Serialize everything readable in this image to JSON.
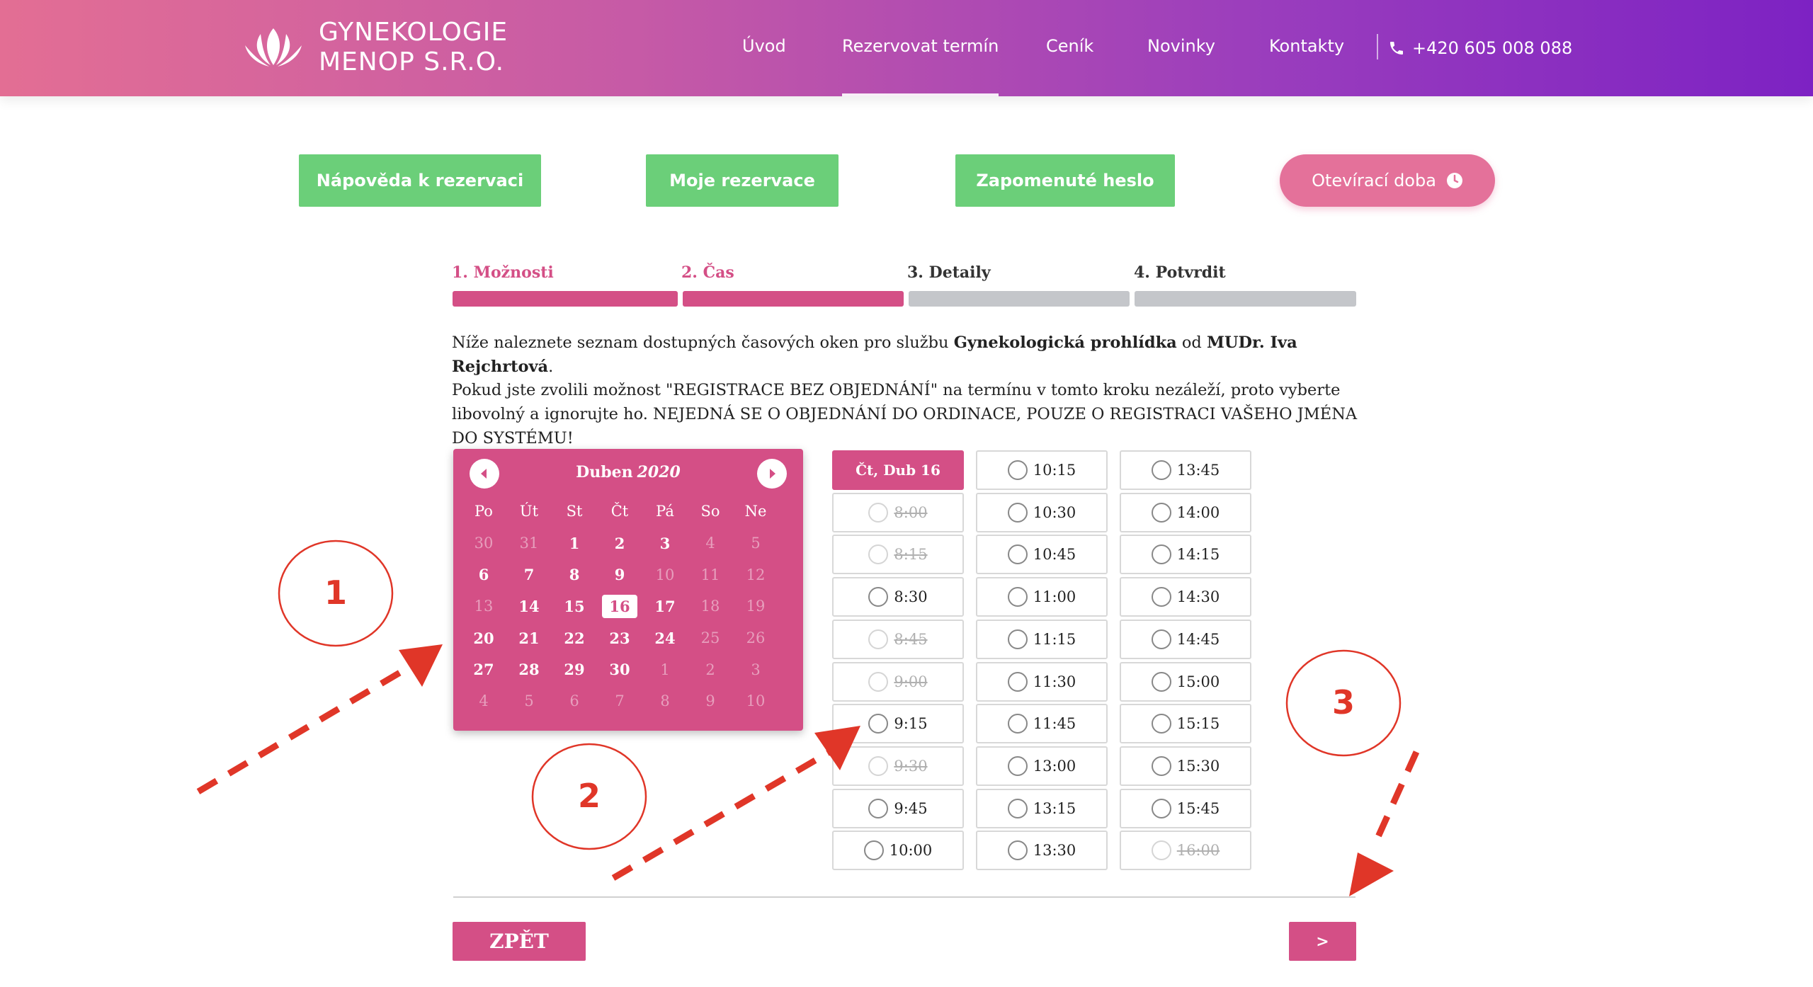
{
  "brand": {
    "line1": "GYNEKOLOGIE",
    "line2": "MENOP S.R.O."
  },
  "nav": {
    "items": [
      "Úvod",
      "Rezervovat termín",
      "Ceník",
      "Novinky",
      "Kontakty"
    ],
    "active": "Rezervovat termín",
    "phone": "+420 605 008 088"
  },
  "top_buttons": {
    "help": "Nápověda k rezervaci",
    "my_reservations": "Moje rezervace",
    "forgot_password": "Zapomenuté heslo",
    "opening_hours": "Otevírací doba"
  },
  "steps": [
    {
      "label": "1. Možnosti",
      "state": "done"
    },
    {
      "label": "2. Čas",
      "state": "done"
    },
    {
      "label": "3. Detaily",
      "state": "todo"
    },
    {
      "label": "4. Potvrdit",
      "state": "todo"
    }
  ],
  "intro": {
    "p1_a": "Níže naleznete seznam dostupných časových oken pro službu ",
    "p1_service": "Gynekologická prohlídka",
    "p1_b": " od ",
    "p1_doctor": "MUDr. Iva Rejchrtová",
    "p1_c": ".",
    "p2": "Pokud jste zvolili možnost \"REGISTRACE BEZ OBJEDNÁNÍ\" na termínu v tomto kroku nezáleží, proto vyberte libovolný a ignorujte ho. NEJEDNÁ SE O OBJEDNÁNÍ DO ORDINACE, POUZE O REGISTRACI VAŠEHO JMÉNA DO SYSTÉMU!"
  },
  "calendar": {
    "month": "Duben",
    "year": "2020",
    "weekdays": [
      "Po",
      "Út",
      "St",
      "Čt",
      "Pá",
      "So",
      "Ne"
    ],
    "weeks": [
      [
        {
          "d": "30",
          "s": "dim"
        },
        {
          "d": "31",
          "s": "dim"
        },
        {
          "d": "1",
          "s": "avail"
        },
        {
          "d": "2",
          "s": "avail"
        },
        {
          "d": "3",
          "s": "avail"
        },
        {
          "d": "4",
          "s": "dim"
        },
        {
          "d": "5",
          "s": "dim"
        }
      ],
      [
        {
          "d": "6",
          "s": "avail"
        },
        {
          "d": "7",
          "s": "avail"
        },
        {
          "d": "8",
          "s": "avail"
        },
        {
          "d": "9",
          "s": "avail"
        },
        {
          "d": "10",
          "s": "dim"
        },
        {
          "d": "11",
          "s": "dim"
        },
        {
          "d": "12",
          "s": "dim"
        }
      ],
      [
        {
          "d": "13",
          "s": "dim"
        },
        {
          "d": "14",
          "s": "avail"
        },
        {
          "d": "15",
          "s": "avail"
        },
        {
          "d": "16",
          "s": "sel"
        },
        {
          "d": "17",
          "s": "avail"
        },
        {
          "d": "18",
          "s": "dim"
        },
        {
          "d": "19",
          "s": "dim"
        }
      ],
      [
        {
          "d": "20",
          "s": "avail"
        },
        {
          "d": "21",
          "s": "avail"
        },
        {
          "d": "22",
          "s": "avail"
        },
        {
          "d": "23",
          "s": "avail"
        },
        {
          "d": "24",
          "s": "avail"
        },
        {
          "d": "25",
          "s": "dim"
        },
        {
          "d": "26",
          "s": "dim"
        }
      ],
      [
        {
          "d": "27",
          "s": "avail"
        },
        {
          "d": "28",
          "s": "avail"
        },
        {
          "d": "29",
          "s": "avail"
        },
        {
          "d": "30",
          "s": "avail"
        },
        {
          "d": "1",
          "s": "dim"
        },
        {
          "d": "2",
          "s": "dim"
        },
        {
          "d": "3",
          "s": "dim"
        }
      ],
      [
        {
          "d": "4",
          "s": "dim"
        },
        {
          "d": "5",
          "s": "dim"
        },
        {
          "d": "6",
          "s": "dim"
        },
        {
          "d": "7",
          "s": "dim"
        },
        {
          "d": "8",
          "s": "dim"
        },
        {
          "d": "9",
          "s": "dim"
        },
        {
          "d": "10",
          "s": "dim"
        }
      ]
    ]
  },
  "slots": {
    "day_header": "Čt, Dub 16",
    "columns": [
      [
        {
          "t": "8:00",
          "off": true
        },
        {
          "t": "8:15",
          "off": true
        },
        {
          "t": "8:30",
          "off": false
        },
        {
          "t": "8:45",
          "off": true
        },
        {
          "t": "9:00",
          "off": true
        },
        {
          "t": "9:15",
          "off": false
        },
        {
          "t": "9:30",
          "off": true
        },
        {
          "t": "9:45",
          "off": false
        },
        {
          "t": "10:00",
          "off": false
        }
      ],
      [
        {
          "t": "10:15",
          "off": false
        },
        {
          "t": "10:30",
          "off": false
        },
        {
          "t": "10:45",
          "off": false
        },
        {
          "t": "11:00",
          "off": false
        },
        {
          "t": "11:15",
          "off": false
        },
        {
          "t": "11:30",
          "off": false
        },
        {
          "t": "11:45",
          "off": false
        },
        {
          "t": "13:00",
          "off": false
        },
        {
          "t": "13:15",
          "off": false
        },
        {
          "t": "13:30",
          "off": false
        }
      ],
      [
        {
          "t": "13:45",
          "off": false
        },
        {
          "t": "14:00",
          "off": false
        },
        {
          "t": "14:15",
          "off": false
        },
        {
          "t": "14:30",
          "off": false
        },
        {
          "t": "14:45",
          "off": false
        },
        {
          "t": "15:00",
          "off": false
        },
        {
          "t": "15:15",
          "off": false
        },
        {
          "t": "15:30",
          "off": false
        },
        {
          "t": "15:45",
          "off": false
        },
        {
          "t": "16:00",
          "off": true
        }
      ]
    ]
  },
  "annotations": [
    "1",
    "2",
    "3"
  ],
  "footer": {
    "back": "ZPĚT",
    "next": ">"
  },
  "colors": {
    "primary": "#d44f86",
    "green": "#6bcf79",
    "annotation": "#e03628"
  }
}
